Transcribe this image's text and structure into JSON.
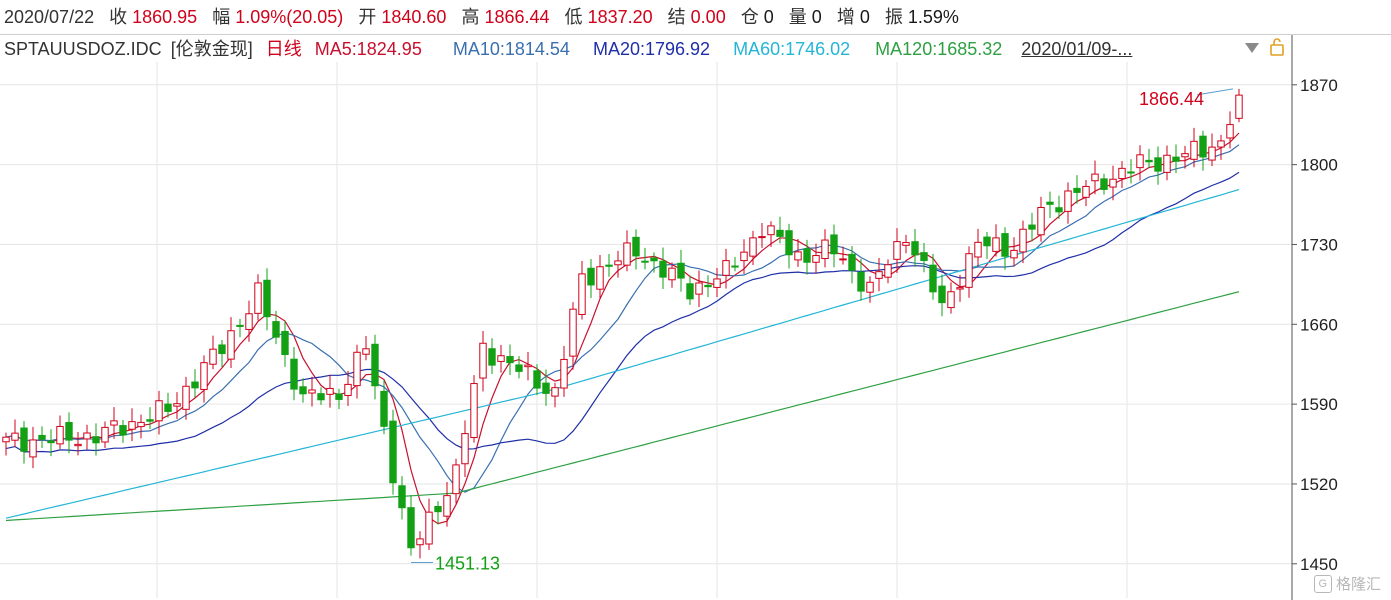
{
  "header": {
    "date": "2020/07/22",
    "close_label": "收",
    "close_value": "1860.95",
    "change_label": "幅",
    "change_value": "1.09%(20.05)",
    "open_label": "开",
    "open_value": "1840.60",
    "high_label": "高",
    "high_value": "1866.44",
    "low_label": "低",
    "low_value": "1837.20",
    "settle_label": "结",
    "settle_value": "0.00",
    "position_label": "仓",
    "position_value": "0",
    "volume_label": "量",
    "volume_value": "0",
    "increase_label": "增",
    "increase_value": "0",
    "amplitude_label": "振",
    "amplitude_value": "1.59%"
  },
  "subheader": {
    "code": "SPTAUUSDOZ.IDC",
    "name": "[伦敦金现]",
    "period": "日线",
    "ma5": "MA5:1824.95",
    "ma10": "MA10:1814.54",
    "ma20": "MA20:1796.92",
    "ma60": "MA60:1746.02",
    "ma120": "MA120:1685.32",
    "range": "2020/01/09-..."
  },
  "colors": {
    "up": "#d0021b",
    "down": "#13a014",
    "ma5": "#c8102e",
    "ma10": "#3a6fb0",
    "ma20": "#1f2fa8",
    "ma60": "#23b5d6",
    "ma120": "#2ea043",
    "grid": "#e6e6e6"
  },
  "watermark": "格隆汇",
  "chart_data": {
    "type": "candlestick",
    "title": "",
    "ylim": [
      1420,
      1890
    ],
    "yticks": [
      1450,
      1520,
      1590,
      1660,
      1730,
      1800,
      1870
    ],
    "grid": true,
    "annotations": [
      {
        "text": "1866.44",
        "value": 1866.44,
        "kind": "high"
      },
      {
        "text": "1451.13",
        "value": 1451.13,
        "kind": "low"
      }
    ],
    "ohlc_anchor_points": [
      {
        "name": "start",
        "close": 1557
      },
      {
        "name": "feb_peak",
        "close": 1686
      },
      {
        "name": "mar_high",
        "close": 1702
      },
      {
        "name": "mar_low",
        "close": 1460
      },
      {
        "name": "apr_high",
        "close": 1745
      },
      {
        "name": "jun_high",
        "close": 1764
      },
      {
        "name": "jul_22",
        "open": 1840.6,
        "high": 1866.44,
        "low": 1837.2,
        "close": 1860.95
      }
    ],
    "series": [
      {
        "name": "MA5",
        "last": 1824.95
      },
      {
        "name": "MA10",
        "last": 1814.54
      },
      {
        "name": "MA20",
        "last": 1796.92
      },
      {
        "name": "MA60",
        "last": 1746.02
      },
      {
        "name": "MA120",
        "last": 1685.32
      }
    ]
  }
}
